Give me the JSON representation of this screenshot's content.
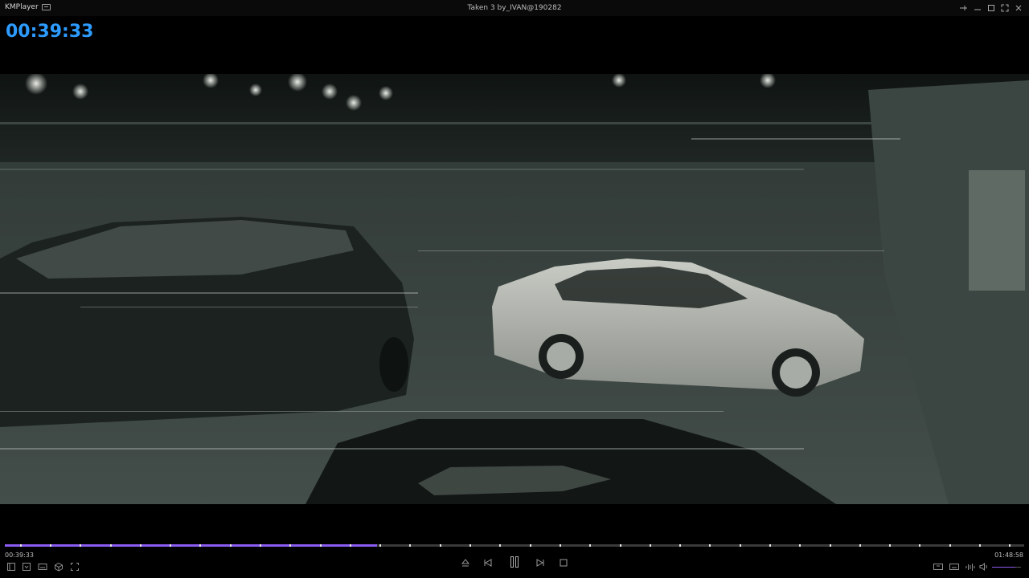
{
  "titlebar": {
    "app_name": "KMPlayer",
    "window_title": "Taken 3 by_IVAN@190282",
    "buttons": [
      "pin-icon",
      "minimize-icon",
      "maximize-icon",
      "fullscreen-icon",
      "close-icon"
    ]
  },
  "overlay": {
    "time": "00:39:33"
  },
  "playback": {
    "current_time": "00:39:33",
    "total_time": "01:48:58",
    "progress": 0.365,
    "volume": 0.8,
    "accent_color": "#8a5cf0",
    "overlay_color": "#2d9bff",
    "bookmark_count": 34
  },
  "controls": {
    "left": [
      "playlist-icon",
      "open-icon",
      "subtitle-icon",
      "3d-icon",
      "capture-icon"
    ],
    "center": [
      "eject-icon",
      "previous-icon",
      "pause-icon",
      "next-icon",
      "stop-icon"
    ],
    "right": [
      "vr-icon",
      "captions-icon",
      "equalizer-icon",
      "speaker-icon"
    ]
  }
}
